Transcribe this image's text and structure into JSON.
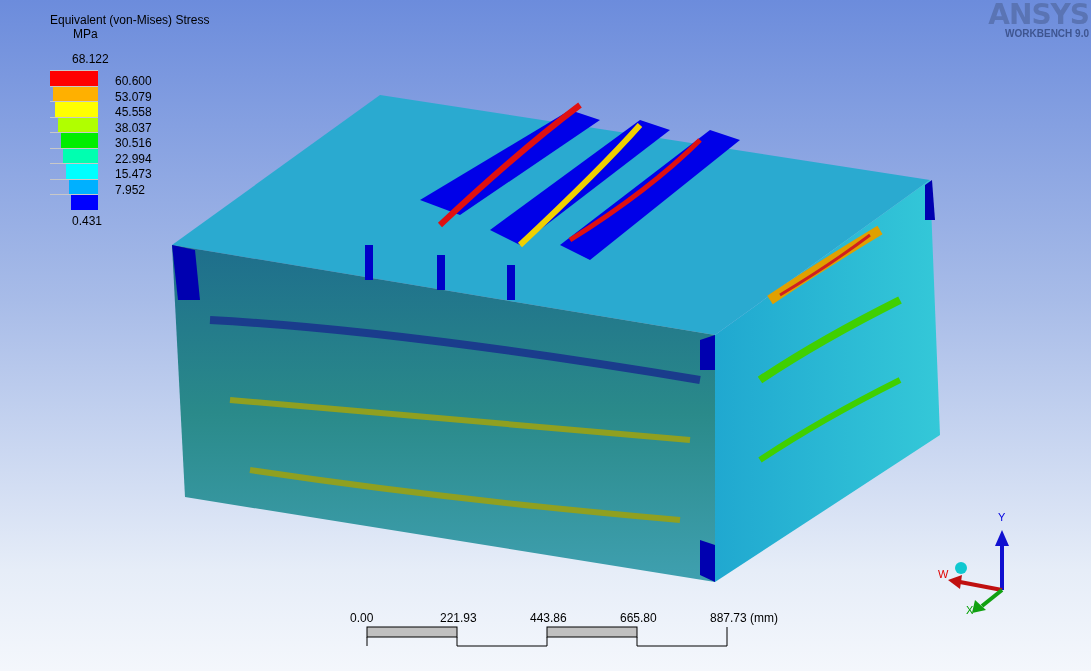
{
  "legend": {
    "title": "Equivalent (von-Mises) Stress",
    "unit": "MPa",
    "max": "68.122",
    "min": "0.431",
    "bands": [
      {
        "color": "#ff0000",
        "label": "60.600"
      },
      {
        "color": "#ffb000",
        "label": "53.079"
      },
      {
        "color": "#ffff00",
        "label": "45.558"
      },
      {
        "color": "#b0ff00",
        "label": "38.037"
      },
      {
        "color": "#00ee00",
        "label": "30.516"
      },
      {
        "color": "#00ffb0",
        "label": "22.994"
      },
      {
        "color": "#00ffff",
        "label": "15.473"
      },
      {
        "color": "#00b0ff",
        "label": "7.952"
      },
      {
        "color": "#0000ff"
      }
    ]
  },
  "logo": {
    "name": "ANSYS",
    "product": "WORKBENCH 9.0"
  },
  "triad": {
    "y_label": "Y",
    "w_label": "W",
    "x_label": "X"
  },
  "scale_bar": {
    "ticks": [
      "0.00",
      "221.93",
      "443.86",
      "665.80",
      "887.73 (mm)"
    ]
  }
}
